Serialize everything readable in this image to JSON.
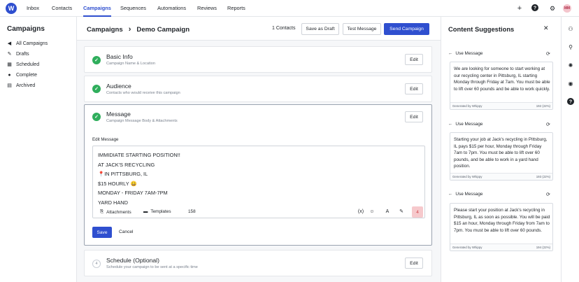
{
  "topnav": {
    "logo": "W",
    "items": [
      {
        "label": "Inbox",
        "active": false
      },
      {
        "label": "Contacts",
        "active": false
      },
      {
        "label": "Campaigns",
        "active": true
      },
      {
        "label": "Sequences",
        "active": false
      },
      {
        "label": "Automations",
        "active": false
      },
      {
        "label": "Reviews",
        "active": false
      },
      {
        "label": "Reports",
        "active": false
      }
    ],
    "icons": [
      "plus-icon",
      "help-icon",
      "gear-icon"
    ],
    "avatar": "MM"
  },
  "sidebar": {
    "title": "Campaigns",
    "items": [
      {
        "label": "All Campaigns",
        "icon": "megaphone-icon"
      },
      {
        "label": "Drafts",
        "icon": "pencil-icon"
      },
      {
        "label": "Scheduled",
        "icon": "calendar-icon"
      },
      {
        "label": "Complete",
        "icon": "check-circle-icon"
      },
      {
        "label": "Archived",
        "icon": "archive-icon"
      }
    ]
  },
  "header": {
    "breadcrumb_root": "Campaigns",
    "breadcrumb_current": "Demo Campaign",
    "contacts": "1 Contacts",
    "save_draft": "Save as Draft",
    "test_message": "Test Message",
    "send_campaign": "Send Campaign"
  },
  "sections": {
    "basic": {
      "title": "Basic Info",
      "subtitle": "Campaign Name & Location",
      "edit": "Edit"
    },
    "audience": {
      "title": "Audience",
      "subtitle": "Contacts who would receive this campaign",
      "edit": "Edit"
    },
    "message": {
      "title": "Message",
      "subtitle": "Campaign Message Body & Attachments",
      "edit": "Edit",
      "edit_label": "Edit Message",
      "lines": [
        "IMMIDIATE STARTING POSITION!!",
        "AT JACK'S RECYCLING",
        "📍IN PITTSBURG, IL",
        "$15 HOURLY 😀",
        "MONDAY - FRIDAY 7AM-7PM",
        "YARD HAND"
      ],
      "attachments": "Attachments",
      "templates": "Templates",
      "char_count": "158",
      "segments": "4",
      "save": "Save",
      "cancel": "Cancel"
    },
    "schedule": {
      "step": "4",
      "title": "Schedule (Optional)",
      "subtitle": "Schedule your campaign to be sent at a specific time",
      "edit": "Edit"
    }
  },
  "suggestions": {
    "title": "Content Suggestions",
    "use_label": "Use Message",
    "generated_by": "Generated by Whippy",
    "items": [
      {
        "text": "We are looking for someone to start working at our recycling center in Pittsburg, IL starting Monday through Friday at 7am. You must be able to lift over 60 pounds and be able to work quickly.",
        "count": "192 (22%)"
      },
      {
        "text": "Starting your job at Jack's recycling in Pittsburg, IL pays $15 per hour, Monday through Friday 7am to 7pm. You must be able to lift over 60 pounds, and be able to work in a yard hand position.",
        "count": "193 (22%)"
      },
      {
        "text": "Please start your position at Jack's recycling in Pittsburg, IL as soon as possible. You will be paid $15 an hour, Monday through Friday from 7am to 7pm. You must be able to lift over 60 pounds.",
        "count": "194 (22%)"
      }
    ]
  },
  "rail": {
    "icons": [
      "users-group-icon",
      "user-plus-icon",
      "lightbulb-icon",
      "eye-icon",
      "help-icon"
    ]
  }
}
